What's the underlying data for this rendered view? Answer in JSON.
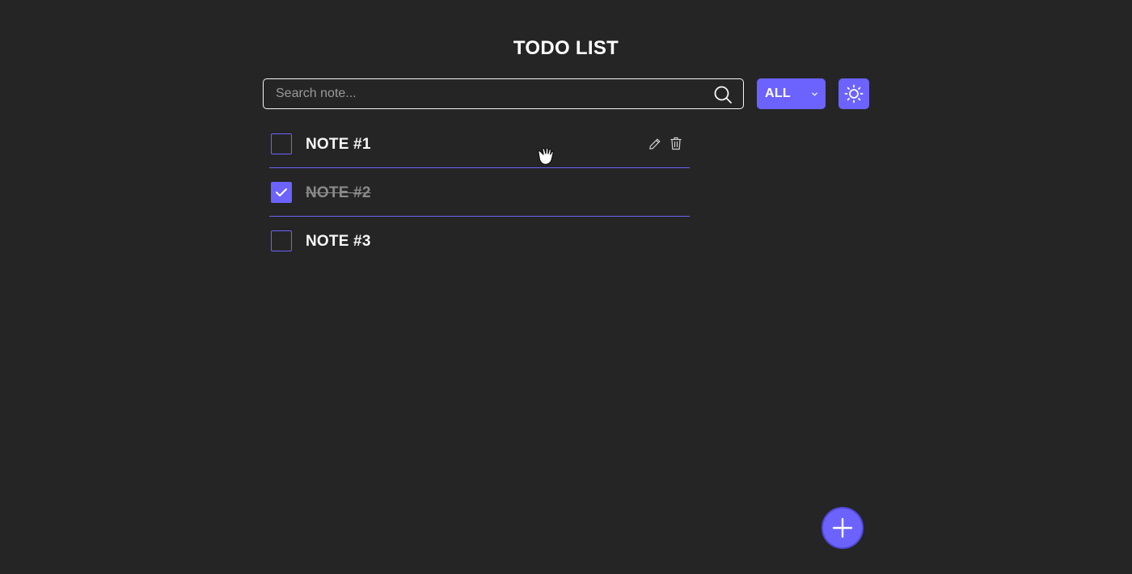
{
  "header": {
    "title": "TODO LIST"
  },
  "search": {
    "placeholder": "Search note...",
    "value": "",
    "icon": "search-icon"
  },
  "filter": {
    "selected": "ALL",
    "icon": "chevron-down-icon"
  },
  "theme_toggle": {
    "icon": "sun-icon"
  },
  "notes": [
    {
      "label": "NOTE #1",
      "completed": false
    },
    {
      "label": "NOTE #2",
      "completed": true
    },
    {
      "label": "NOTE #3",
      "completed": false
    }
  ],
  "add_button": {
    "icon": "plus-icon"
  },
  "colors": {
    "background": "#252525",
    "accent": "#6c63ff",
    "text": "#f7f7f7",
    "completed_text": "#8a8a8a"
  }
}
